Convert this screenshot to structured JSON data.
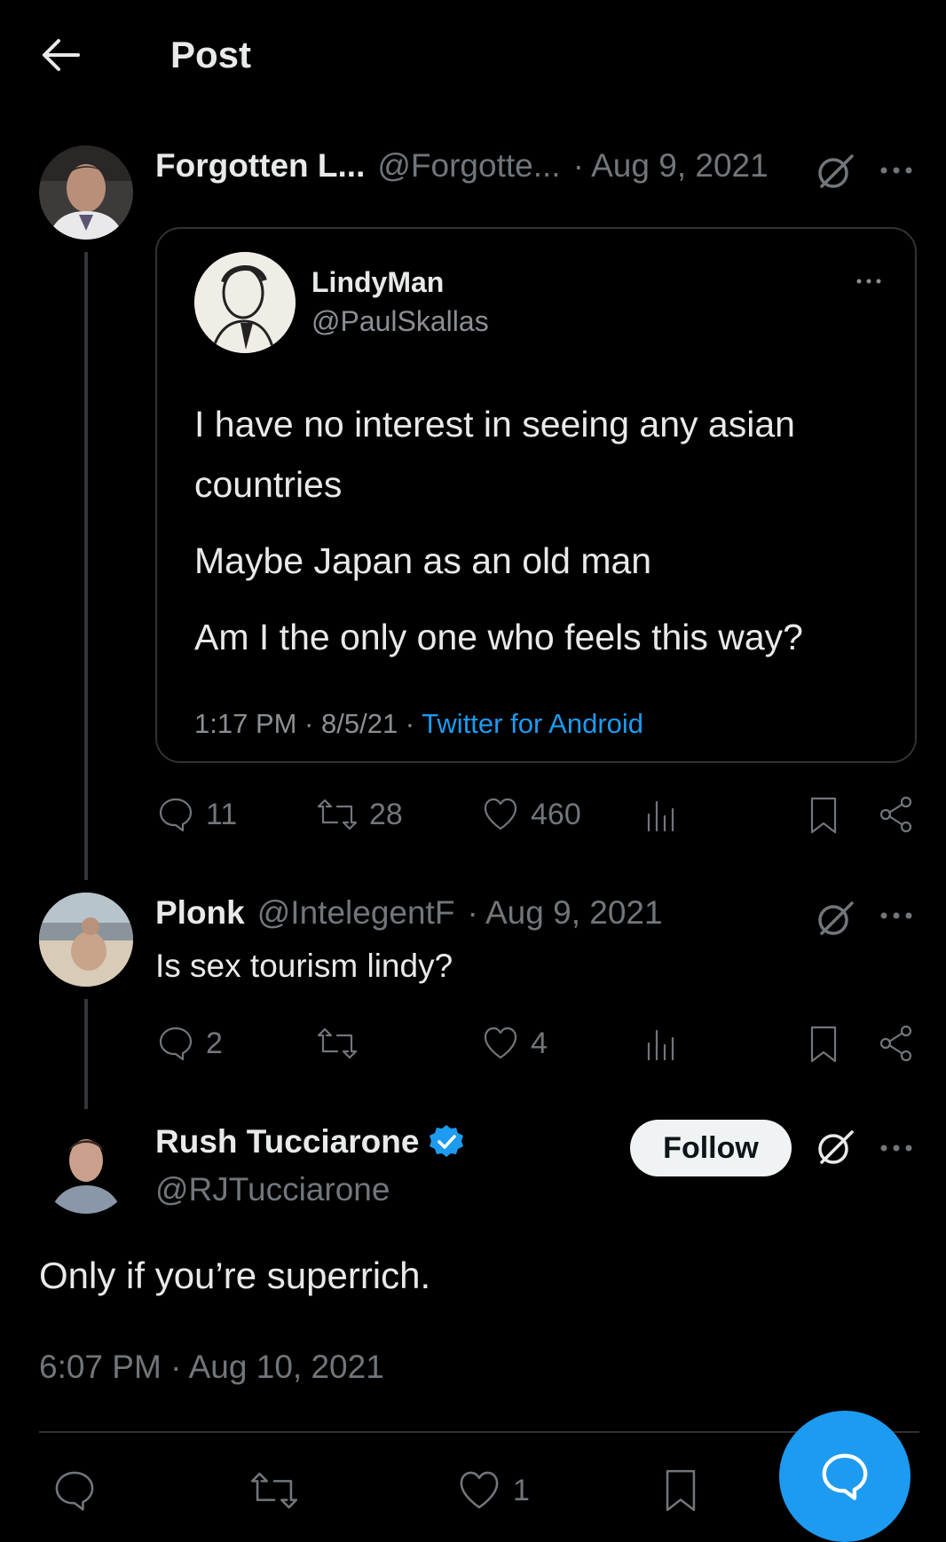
{
  "header": {
    "title": "Post"
  },
  "tweet1": {
    "name": "Forgotten L...",
    "handle": "@Forgotte...",
    "date": "· Aug 9, 2021",
    "quoted": {
      "name": "LindyMan",
      "handle": "@PaulSkallas",
      "line1": "I have no interest in seeing any asian",
      "line2": "countries",
      "line3": "Maybe Japan as an old man",
      "line4": "Am I the only one who feels this way?",
      "time": "1:17 PM · 8/5/21 ·",
      "source": "Twitter for Android"
    },
    "replies": "11",
    "reposts": "28",
    "likes": "460"
  },
  "tweet2": {
    "name": "Plonk",
    "handle": "@IntelegentF",
    "date": "· Aug 9, 2021",
    "text": "Is sex tourism lindy?",
    "replies": "2",
    "likes": "4"
  },
  "tweet3": {
    "name": "Rush Tucciarone",
    "handle": "@RJTucciarone",
    "follow_label": "Follow",
    "text": "Only if you’re superrich.",
    "timestamp": "6:07 PM · Aug 10, 2021",
    "likes": "1"
  },
  "colors": {
    "accent": "#1d9bf0",
    "muted": "#71767b",
    "background": "#000000"
  }
}
